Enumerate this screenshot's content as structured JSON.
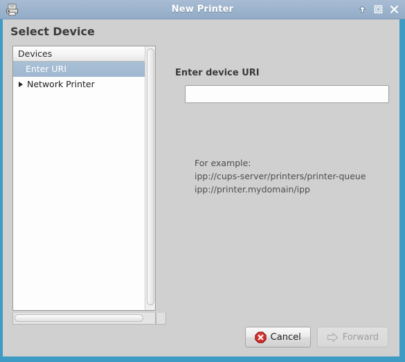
{
  "window": {
    "title": "New Printer",
    "icon": "printer-icon",
    "controls": [
      {
        "name": "shade-button",
        "glyph": "⬆"
      },
      {
        "name": "maximize-button",
        "glyph": "☐"
      },
      {
        "name": "close-button",
        "glyph": "✕"
      }
    ]
  },
  "page": {
    "heading": "Select Device"
  },
  "devices_list": {
    "header": "Devices",
    "items": [
      {
        "label": "Enter URI",
        "selected": true,
        "expandable": false
      },
      {
        "label": "Network Printer",
        "selected": false,
        "expandable": true
      }
    ]
  },
  "device_uri": {
    "label": "Enter device URI",
    "value": "",
    "placeholder": ""
  },
  "example": {
    "heading": "For example:",
    "lines": [
      "ipp://cups-server/printers/printer-queue",
      "ipp://printer.mydomain/ipp"
    ]
  },
  "footer": {
    "cancel_label": "Cancel",
    "forward_label": "Forward",
    "forward_enabled": false
  },
  "colors": {
    "window_border": "#3e9bc4",
    "titlebar": "#9db4cd",
    "panel_bg": "#d0d0d0",
    "selection": "#9fb7d0",
    "cancel_icon": "#cc2222"
  }
}
